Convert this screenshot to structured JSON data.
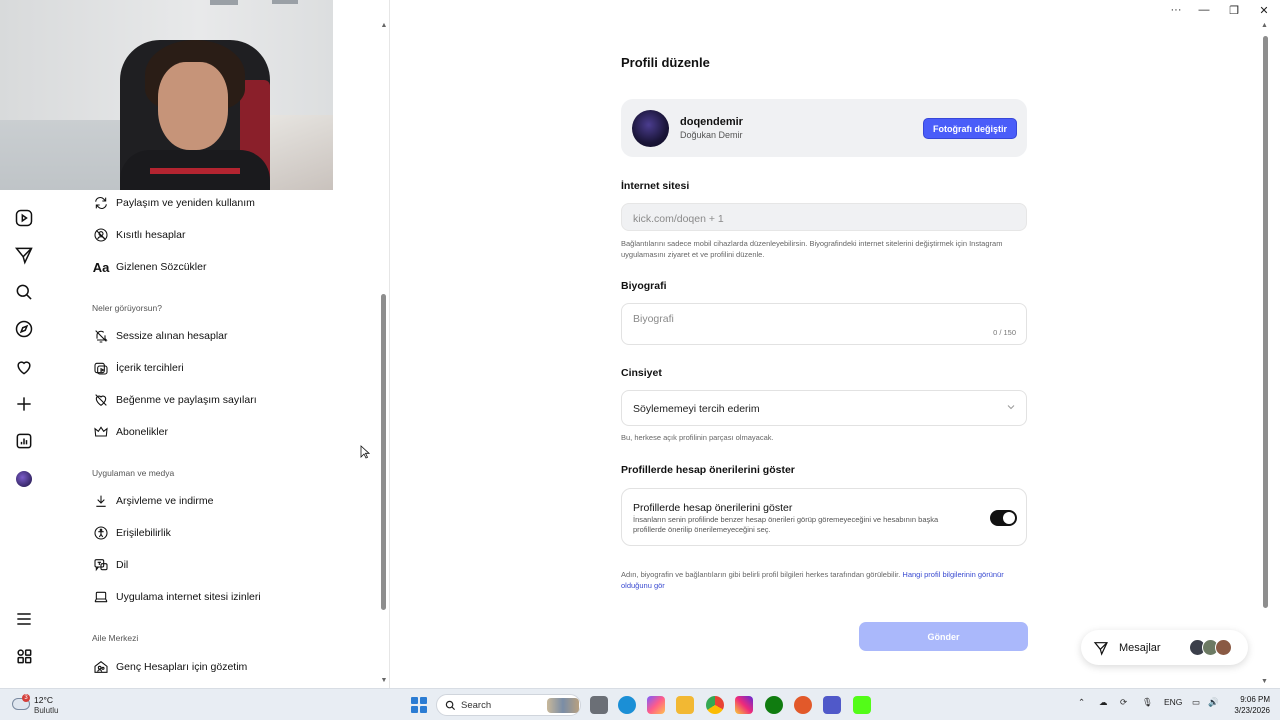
{
  "window": {
    "more": "···",
    "minimize": "—",
    "restore": "❐",
    "close": "✕"
  },
  "sidebar": {
    "items_a": [
      {
        "label": "Paylaşım ve yeniden kullanım",
        "icon": "reshare-icon"
      },
      {
        "label": "Kısıtlı hesaplar",
        "icon": "restricted-icon"
      },
      {
        "label": "Gizlenen Sözcükler",
        "icon": "text-icon"
      }
    ],
    "section_seen": "Neler görüyorsun?",
    "items_b": [
      {
        "label": "Sessize alınan hesaplar",
        "icon": "mute-icon"
      },
      {
        "label": "İçerik tercihleri",
        "icon": "content-icon"
      },
      {
        "label": "Beğenme ve paylaşım sayıları",
        "icon": "like-count-icon"
      },
      {
        "label": "Abonelikler",
        "icon": "crown-icon"
      }
    ],
    "section_app": "Uygulaman ve medya",
    "items_c": [
      {
        "label": "Arşivleme ve indirme",
        "icon": "download-icon"
      },
      {
        "label": "Erişilebilirlik",
        "icon": "accessibility-icon"
      },
      {
        "label": "Dil",
        "icon": "language-icon"
      },
      {
        "label": "Uygulama internet sitesi izinleri",
        "icon": "laptop-icon"
      }
    ],
    "section_family": "Aile Merkezi",
    "items_d": [
      {
        "label": "Genç Hesapları için gözetim",
        "icon": "family-icon"
      }
    ]
  },
  "main": {
    "title": "Profili düzenle",
    "profile": {
      "username": "doqendemir",
      "fullname": "Doğukan Demir",
      "change_photo": "Fotoğrafı değiştir"
    },
    "website": {
      "label": "İnternet sitesi",
      "value": "kick.com/doqen + 1",
      "help": "Bağlantılarını sadece mobil cihazlarda düzenleyebilirsin. Biyografindeki internet sitelerini değiştirmek için Instagram uygulamasını ziyaret et ve profilini düzenle."
    },
    "bio": {
      "label": "Biyografi",
      "placeholder": "Biyografi",
      "counter": "0 / 150"
    },
    "gender": {
      "label": "Cinsiyet",
      "value": "Söylememeyi tercih ederim",
      "help": "Bu, herkese açık profilinin parçası olmayacak."
    },
    "suggestions": {
      "section_label": "Profillerde hesap önerilerini göster",
      "card_title": "Profillerde hesap önerilerini göster",
      "card_desc": "İnsanların senin profilinde benzer hesap önerileri görüp göremeyeceğini ve hesabının başka profillerde önerilip önerilemeyeceğini seç.",
      "enabled": true
    },
    "footer_note": "Adın, biyografin ve bağlantıların gibi belirli profil bilgileri herkes tarafından görülebilir.",
    "footer_link": "Hangi profil bilgilerinin görünür olduğunu gör",
    "submit": "Gönder"
  },
  "messages": {
    "label": "Mesajlar"
  },
  "taskbar": {
    "weather_temp": "12°C",
    "weather_cond": "Bulutlu",
    "weather_badge": "3",
    "search": "Search",
    "lang": "ENG",
    "time": "9:06 PM",
    "date": "3/23/2026"
  },
  "colors": {
    "accent": "#4a5df9",
    "submit_disabled": "#aab8fb",
    "toggle_on": "#111111"
  }
}
